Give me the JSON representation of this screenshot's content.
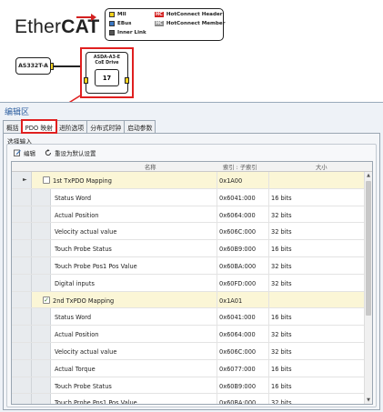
{
  "diagram": {
    "logo_text": "Ether",
    "logo_bold": "CAT",
    "legend": [
      {
        "swatch": "yellow",
        "label": "MII"
      },
      {
        "swatch": "blue",
        "label": "EBus"
      },
      {
        "swatch": "dark",
        "label": "Inner Link"
      }
    ],
    "legend_hc": [
      {
        "badge": "HC",
        "badge_color": "#d32020",
        "label": "HotConnect Header"
      },
      {
        "badge": "HC",
        "badge_color": "#8a8a8a",
        "label": "HotConnect Member"
      }
    ],
    "master_label": "AS332T-A",
    "drive_title_line1": "ASDA-A3-E",
    "drive_title_line2": "CoE Drive",
    "drive_number": "17",
    "accent_red": "#e02020"
  },
  "editor": {
    "title": "编辑区",
    "tabs": [
      {
        "label": "概括",
        "active": false
      },
      {
        "label": "PDO 映射",
        "active": true
      },
      {
        "label": "进阶选项",
        "active": false
      },
      {
        "label": "分布式时钟",
        "active": false
      },
      {
        "label": "启动参数",
        "active": false
      }
    ],
    "group_label": "选择输入",
    "toolbar": {
      "edit_label": "编辑",
      "reset_label": "重设为默认设置"
    },
    "columns": {
      "name": "名称",
      "index": "索引 : 子索引",
      "size": "大小"
    },
    "rows": [
      {
        "kind": "group",
        "checked": false,
        "name": "1st TxPDO Mapping",
        "index": "0x1A00",
        "size": ""
      },
      {
        "kind": "item",
        "name": "Status Word",
        "index": "0x6041:000",
        "size": "16 bits"
      },
      {
        "kind": "item",
        "name": "Actual Position",
        "index": "0x6064:000",
        "size": "32 bits"
      },
      {
        "kind": "item",
        "name": "Velocity actual value",
        "index": "0x606C:000",
        "size": "32 bits"
      },
      {
        "kind": "item",
        "name": "Touch Probe Status",
        "index": "0x60B9:000",
        "size": "16 bits"
      },
      {
        "kind": "item",
        "name": "Touch Probe Pos1 Pos Value",
        "index": "0x60BA:000",
        "size": "32 bits"
      },
      {
        "kind": "item",
        "name": "Digital inputs",
        "index": "0x60FD:000",
        "size": "32 bits"
      },
      {
        "kind": "group",
        "checked": true,
        "name": "2nd TxPDO Mapping",
        "index": "0x1A01",
        "size": ""
      },
      {
        "kind": "item",
        "name": "Status Word",
        "index": "0x6041:000",
        "size": "16 bits"
      },
      {
        "kind": "item",
        "name": "Actual Position",
        "index": "0x6064:000",
        "size": "32 bits"
      },
      {
        "kind": "item",
        "name": "Velocity actual value",
        "index": "0x606C:000",
        "size": "32 bits"
      },
      {
        "kind": "item",
        "name": "Actual Torque",
        "index": "0x6077:000",
        "size": "16 bits"
      },
      {
        "kind": "item",
        "name": "Touch Probe Status",
        "index": "0x60B9:000",
        "size": "16 bits"
      },
      {
        "kind": "item",
        "name": "Touch Probe Pos1 Pos Value",
        "index": "0x60BA:000",
        "size": "32 bits"
      }
    ]
  }
}
